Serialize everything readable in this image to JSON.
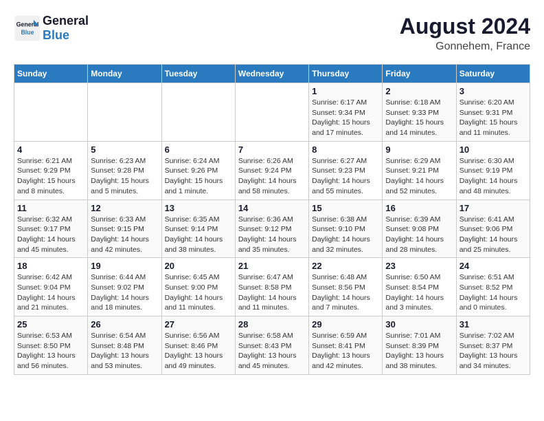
{
  "header": {
    "logo_line1": "General",
    "logo_line2": "Blue",
    "month_year": "August 2024",
    "location": "Gonnehem, France"
  },
  "weekdays": [
    "Sunday",
    "Monday",
    "Tuesday",
    "Wednesday",
    "Thursday",
    "Friday",
    "Saturday"
  ],
  "weeks": [
    [
      {
        "day": "",
        "info": ""
      },
      {
        "day": "",
        "info": ""
      },
      {
        "day": "",
        "info": ""
      },
      {
        "day": "",
        "info": ""
      },
      {
        "day": "1",
        "info": "Sunrise: 6:17 AM\nSunset: 9:34 PM\nDaylight: 15 hours\nand 17 minutes."
      },
      {
        "day": "2",
        "info": "Sunrise: 6:18 AM\nSunset: 9:33 PM\nDaylight: 15 hours\nand 14 minutes."
      },
      {
        "day": "3",
        "info": "Sunrise: 6:20 AM\nSunset: 9:31 PM\nDaylight: 15 hours\nand 11 minutes."
      }
    ],
    [
      {
        "day": "4",
        "info": "Sunrise: 6:21 AM\nSunset: 9:29 PM\nDaylight: 15 hours\nand 8 minutes."
      },
      {
        "day": "5",
        "info": "Sunrise: 6:23 AM\nSunset: 9:28 PM\nDaylight: 15 hours\nand 5 minutes."
      },
      {
        "day": "6",
        "info": "Sunrise: 6:24 AM\nSunset: 9:26 PM\nDaylight: 15 hours\nand 1 minute."
      },
      {
        "day": "7",
        "info": "Sunrise: 6:26 AM\nSunset: 9:24 PM\nDaylight: 14 hours\nand 58 minutes."
      },
      {
        "day": "8",
        "info": "Sunrise: 6:27 AM\nSunset: 9:23 PM\nDaylight: 14 hours\nand 55 minutes."
      },
      {
        "day": "9",
        "info": "Sunrise: 6:29 AM\nSunset: 9:21 PM\nDaylight: 14 hours\nand 52 minutes."
      },
      {
        "day": "10",
        "info": "Sunrise: 6:30 AM\nSunset: 9:19 PM\nDaylight: 14 hours\nand 48 minutes."
      }
    ],
    [
      {
        "day": "11",
        "info": "Sunrise: 6:32 AM\nSunset: 9:17 PM\nDaylight: 14 hours\nand 45 minutes."
      },
      {
        "day": "12",
        "info": "Sunrise: 6:33 AM\nSunset: 9:15 PM\nDaylight: 14 hours\nand 42 minutes."
      },
      {
        "day": "13",
        "info": "Sunrise: 6:35 AM\nSunset: 9:14 PM\nDaylight: 14 hours\nand 38 minutes."
      },
      {
        "day": "14",
        "info": "Sunrise: 6:36 AM\nSunset: 9:12 PM\nDaylight: 14 hours\nand 35 minutes."
      },
      {
        "day": "15",
        "info": "Sunrise: 6:38 AM\nSunset: 9:10 PM\nDaylight: 14 hours\nand 32 minutes."
      },
      {
        "day": "16",
        "info": "Sunrise: 6:39 AM\nSunset: 9:08 PM\nDaylight: 14 hours\nand 28 minutes."
      },
      {
        "day": "17",
        "info": "Sunrise: 6:41 AM\nSunset: 9:06 PM\nDaylight: 14 hours\nand 25 minutes."
      }
    ],
    [
      {
        "day": "18",
        "info": "Sunrise: 6:42 AM\nSunset: 9:04 PM\nDaylight: 14 hours\nand 21 minutes."
      },
      {
        "day": "19",
        "info": "Sunrise: 6:44 AM\nSunset: 9:02 PM\nDaylight: 14 hours\nand 18 minutes."
      },
      {
        "day": "20",
        "info": "Sunrise: 6:45 AM\nSunset: 9:00 PM\nDaylight: 14 hours\nand 11 minutes."
      },
      {
        "day": "21",
        "info": "Sunrise: 6:47 AM\nSunset: 8:58 PM\nDaylight: 14 hours\nand 11 minutes."
      },
      {
        "day": "22",
        "info": "Sunrise: 6:48 AM\nSunset: 8:56 PM\nDaylight: 14 hours\nand 7 minutes."
      },
      {
        "day": "23",
        "info": "Sunrise: 6:50 AM\nSunset: 8:54 PM\nDaylight: 14 hours\nand 3 minutes."
      },
      {
        "day": "24",
        "info": "Sunrise: 6:51 AM\nSunset: 8:52 PM\nDaylight: 14 hours\nand 0 minutes."
      }
    ],
    [
      {
        "day": "25",
        "info": "Sunrise: 6:53 AM\nSunset: 8:50 PM\nDaylight: 13 hours\nand 56 minutes."
      },
      {
        "day": "26",
        "info": "Sunrise: 6:54 AM\nSunset: 8:48 PM\nDaylight: 13 hours\nand 53 minutes."
      },
      {
        "day": "27",
        "info": "Sunrise: 6:56 AM\nSunset: 8:46 PM\nDaylight: 13 hours\nand 49 minutes."
      },
      {
        "day": "28",
        "info": "Sunrise: 6:58 AM\nSunset: 8:43 PM\nDaylight: 13 hours\nand 45 minutes."
      },
      {
        "day": "29",
        "info": "Sunrise: 6:59 AM\nSunset: 8:41 PM\nDaylight: 13 hours\nand 42 minutes."
      },
      {
        "day": "30",
        "info": "Sunrise: 7:01 AM\nSunset: 8:39 PM\nDaylight: 13 hours\nand 38 minutes."
      },
      {
        "day": "31",
        "info": "Sunrise: 7:02 AM\nSunset: 8:37 PM\nDaylight: 13 hours\nand 34 minutes."
      }
    ]
  ]
}
